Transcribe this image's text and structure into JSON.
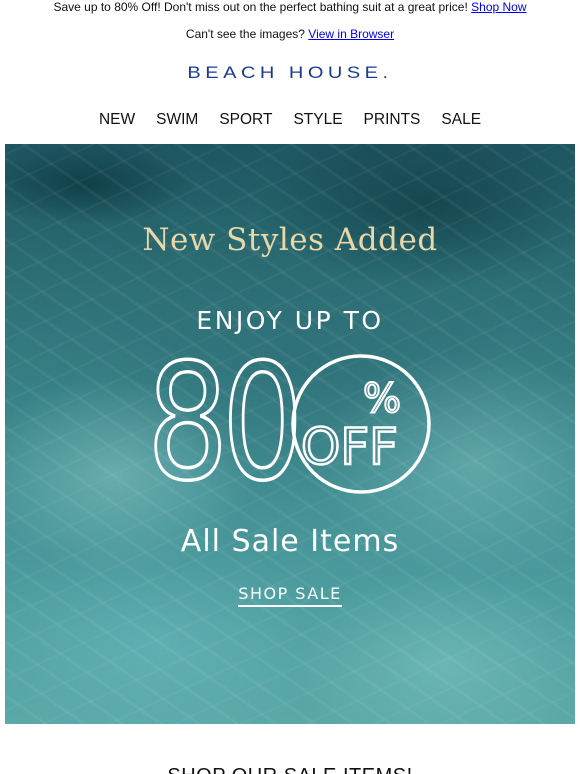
{
  "preheader": {
    "text": "Save up to 80% Off! Don't miss out on the perfect bathing suit at a great price!",
    "link_label": "Shop Now"
  },
  "browser_line": {
    "text": "Can't see the images?",
    "link_label": "View in Browser"
  },
  "brand": {
    "logo_text": "BEACH HOUSE.",
    "color": "#1a3c8c"
  },
  "nav": {
    "items": [
      {
        "label": "NEW"
      },
      {
        "label": "SWIM"
      },
      {
        "label": "SPORT"
      },
      {
        "label": "STYLE"
      },
      {
        "label": "PRINTS"
      },
      {
        "label": "SALE"
      }
    ]
  },
  "hero": {
    "headline": "New Styles Added",
    "subhead": "ENJOY UP TO",
    "discount_number": "80",
    "percent_symbol": "%",
    "off_label": "OFF",
    "tagline": "All Sale Items",
    "cta_label": "SHOP SALE",
    "headline_color": "#e8d7a8"
  },
  "section": {
    "heading": "SHOP OUR SALE ITEMS!"
  }
}
